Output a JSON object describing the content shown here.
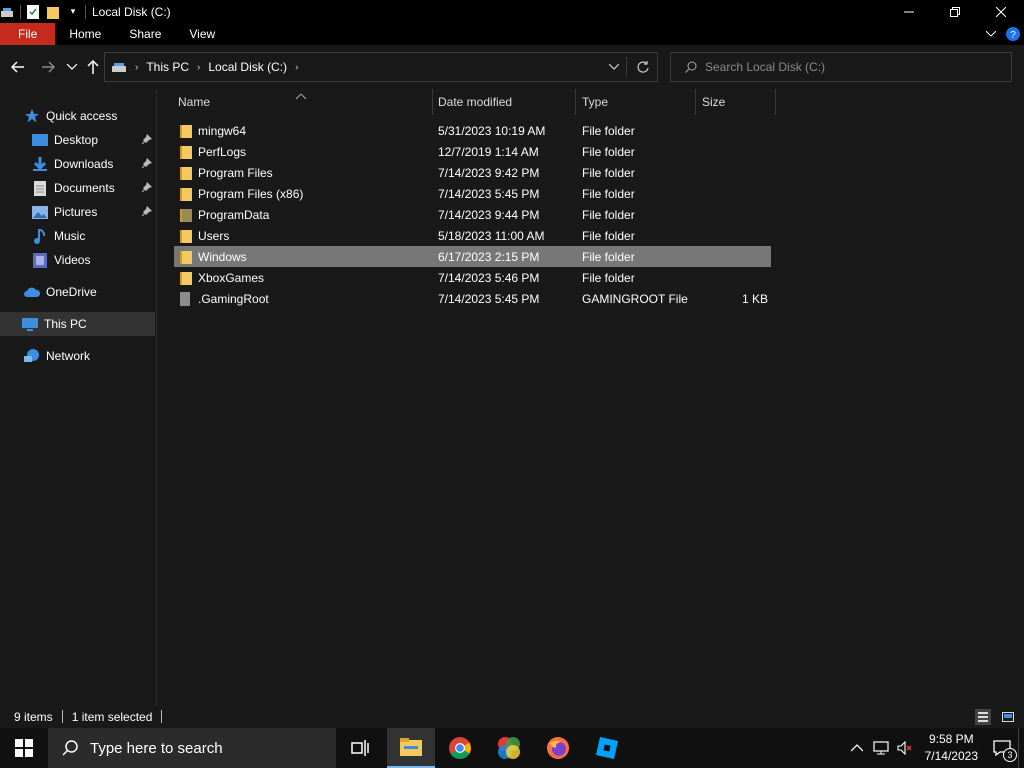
{
  "window": {
    "title": "Local Disk (C:)"
  },
  "ribbon": {
    "tabs": [
      "File",
      "Home",
      "Share",
      "View"
    ]
  },
  "address": {
    "crumbs": [
      "This PC",
      "Local Disk (C:)"
    ]
  },
  "search": {
    "placeholder": "Search Local Disk (C:)"
  },
  "sidebar": {
    "quick_access": "Quick access",
    "items": [
      {
        "label": "Desktop",
        "icon": "desktop-icon",
        "pinned": true
      },
      {
        "label": "Downloads",
        "icon": "downloads-icon",
        "pinned": true
      },
      {
        "label": "Documents",
        "icon": "documents-icon",
        "pinned": true
      },
      {
        "label": "Pictures",
        "icon": "pictures-icon",
        "pinned": true
      },
      {
        "label": "Music",
        "icon": "music-icon",
        "pinned": false
      },
      {
        "label": "Videos",
        "icon": "videos-icon",
        "pinned": false
      }
    ],
    "onedrive": "OneDrive",
    "this_pc": "This PC",
    "network": "Network"
  },
  "columns": [
    "Name",
    "Date modified",
    "Type",
    "Size"
  ],
  "files": [
    {
      "name": "mingw64",
      "date": "5/31/2023 10:19 AM",
      "type": "File folder",
      "size": ""
    },
    {
      "name": "PerfLogs",
      "date": "12/7/2019 1:14 AM",
      "type": "File folder",
      "size": ""
    },
    {
      "name": "Program Files",
      "date": "7/14/2023 9:42 PM",
      "type": "File folder",
      "size": ""
    },
    {
      "name": "Program Files (x86)",
      "date": "7/14/2023 5:45 PM",
      "type": "File folder",
      "size": ""
    },
    {
      "name": "ProgramData",
      "date": "7/14/2023 9:44 PM",
      "type": "File folder",
      "size": ""
    },
    {
      "name": "Users",
      "date": "5/18/2023 11:00 AM",
      "type": "File folder",
      "size": ""
    },
    {
      "name": "Windows",
      "date": "6/17/2023 2:15 PM",
      "type": "File folder",
      "size": ""
    },
    {
      "name": "XboxGames",
      "date": "7/14/2023 5:46 PM",
      "type": "File folder",
      "size": ""
    },
    {
      "name": ".GamingRoot",
      "date": "7/14/2023 5:45 PM",
      "type": "GAMINGROOT File",
      "size": "1 KB"
    }
  ],
  "status": {
    "items": "9 items",
    "selected": "1 item selected"
  },
  "taskbar": {
    "search_placeholder": "Type here to search",
    "time": "9:58 PM",
    "date": "7/14/2023",
    "notifications": "3"
  },
  "colors": {
    "accent": "#c42b1c",
    "folder": "#f4c95d",
    "selection": "#777777"
  }
}
